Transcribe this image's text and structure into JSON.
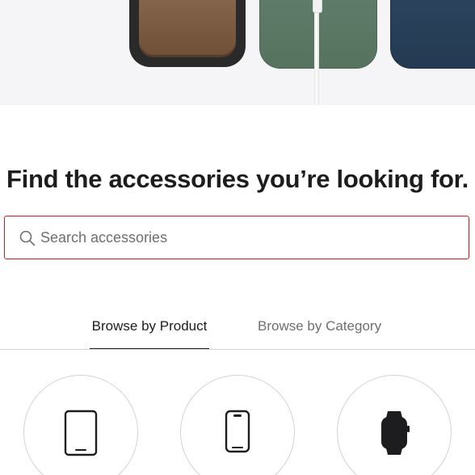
{
  "hero": {
    "products": [
      "wallet-icon",
      "green-case-icon",
      "cable-icon",
      "blue-case-icon"
    ]
  },
  "headline": "Find the accessories you’re looking for.",
  "search": {
    "placeholder": "Search accessories",
    "value": "",
    "icon": "search-icon",
    "focus_color": "#d21a1a"
  },
  "tabs": [
    {
      "label": "Browse by Product",
      "active": true
    },
    {
      "label": "Browse by Category",
      "active": false
    }
  ],
  "products": [
    {
      "icon": "ipad-icon"
    },
    {
      "icon": "iphone-icon"
    },
    {
      "icon": "watch-icon"
    }
  ]
}
